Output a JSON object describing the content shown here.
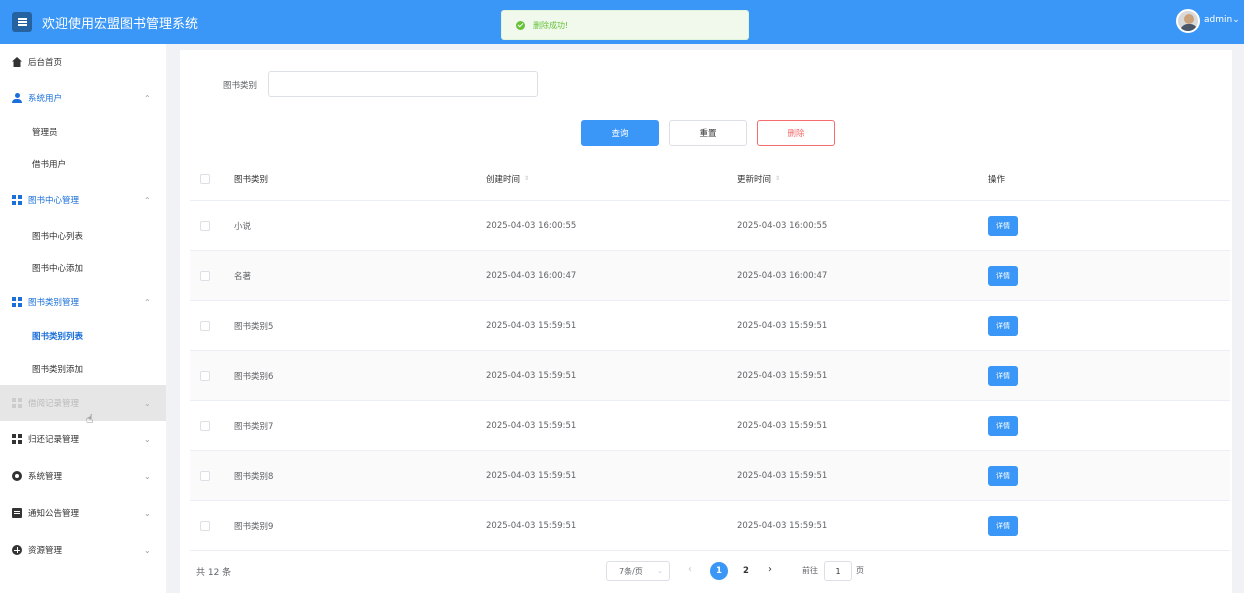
{
  "header": {
    "title": "欢迎使用宏盟图书管理系统",
    "user": "admin",
    "user_caret": "⌄"
  },
  "toast": {
    "message": "删除成功!"
  },
  "sidebar": {
    "items": [
      {
        "label": "后台首页",
        "icon": "home-icon"
      },
      {
        "label": "系统用户",
        "icon": "user-icon",
        "arrow": "⌃"
      },
      {
        "label": "管理员"
      },
      {
        "label": "借书用户"
      },
      {
        "label": "图书中心管理",
        "icon": "grid-icon",
        "arrow": "⌃"
      },
      {
        "label": "图书中心列表"
      },
      {
        "label": "图书中心添加"
      },
      {
        "label": "图书类别管理",
        "icon": "grid-icon",
        "arrow": "⌃"
      },
      {
        "label": "图书类别列表"
      },
      {
        "label": "图书类别添加"
      },
      {
        "label": "借阅记录管理",
        "icon": "grid-icon",
        "arrow": "⌄"
      },
      {
        "label": "归还记录管理",
        "icon": "grid-icon",
        "arrow": "⌄"
      },
      {
        "label": "系统管理",
        "icon": "gear-icon",
        "arrow": "⌄"
      },
      {
        "label": "通知公告管理",
        "icon": "document-icon",
        "arrow": "⌄"
      },
      {
        "label": "资源管理",
        "icon": "plus-circle-icon",
        "arrow": "⌄"
      }
    ]
  },
  "filter": {
    "label": "图书类别",
    "value": "",
    "placeholder": ""
  },
  "buttons": {
    "search": "查询",
    "reset": "重置",
    "delete": "删除"
  },
  "table": {
    "headers": {
      "name": "图书类别",
      "created": "创建时间",
      "updated": "更新时间",
      "op": "操作"
    },
    "sort_glyph": "⇕",
    "rows": [
      {
        "name": "小说",
        "created": "2025-04-03 16:00:55",
        "updated": "2025-04-03 16:00:55",
        "action": "详情"
      },
      {
        "name": "名著",
        "created": "2025-04-03 16:00:47",
        "updated": "2025-04-03 16:00:47",
        "action": "详情"
      },
      {
        "name": "图书类别5",
        "created": "2025-04-03 15:59:51",
        "updated": "2025-04-03 15:59:51",
        "action": "详情"
      },
      {
        "name": "图书类别6",
        "created": "2025-04-03 15:59:51",
        "updated": "2025-04-03 15:59:51",
        "action": "详情"
      },
      {
        "name": "图书类别7",
        "created": "2025-04-03 15:59:51",
        "updated": "2025-04-03 15:59:51",
        "action": "详情"
      },
      {
        "name": "图书类别8",
        "created": "2025-04-03 15:59:51",
        "updated": "2025-04-03 15:59:51",
        "action": "详情"
      },
      {
        "name": "图书类别9",
        "created": "2025-04-03 15:59:51",
        "updated": "2025-04-03 15:59:51",
        "action": "详情"
      }
    ]
  },
  "pagination": {
    "total": "共 12 条",
    "page_size": "7条/页",
    "pages": [
      "1",
      "2"
    ],
    "current": "1",
    "jump_label": "前往",
    "jump_value": "1",
    "jump_suffix": "页"
  },
  "colors": {
    "primary": "#3a97f7",
    "danger": "#f56c6c",
    "success": "#67c23a",
    "active_menu": "#1a6fd9"
  }
}
